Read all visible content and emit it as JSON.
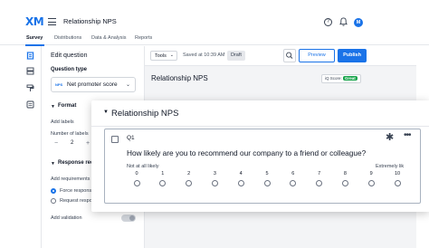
{
  "app": {
    "logo": "XM",
    "project_title": "Relationship NPS"
  },
  "header_icons": [
    "hamburger-icon",
    "help-icon",
    "bell-icon"
  ],
  "user": {
    "avatar_initial": "M"
  },
  "tabs": [
    {
      "label": "Survey",
      "active": true
    },
    {
      "label": "Distributions",
      "active": false
    },
    {
      "label": "Data & Analysis",
      "active": false
    },
    {
      "label": "Reports",
      "active": false
    }
  ],
  "rail_icons": [
    "survey-flow-icon",
    "blocks-icon",
    "paint-roller-icon",
    "document-icon"
  ],
  "edit_panel": {
    "title": "Edit question",
    "question_type_label": "Question type",
    "question_type_icon": "NPS",
    "question_type_value": "Net promoter score",
    "format_label": "Format",
    "add_labels": "Add labels",
    "number_of_labels": "Number of labels",
    "stepper_minus": "−",
    "stepper_value": "2",
    "stepper_plus": "+",
    "response_req_label": "Response requ",
    "add_requirements": "Add requirements",
    "force_response": "Force respons",
    "request_response": "Request respo",
    "add_validation": "Add validation"
  },
  "toolbar": {
    "tools_label": "Tools",
    "tools_chevron": "⌄",
    "saved_text": "Saved at 10:39 AM",
    "draft_badge": "Draft",
    "preview_label": "Preview",
    "publish_label": "Publish"
  },
  "canvas": {
    "block_title": "Relationship NPS",
    "iq_score_label": "iQ Score:",
    "iq_score_value": "Great"
  },
  "floating_card": {
    "block_title": "Relationship NPS",
    "question_id": "Q1",
    "question_text": "How likely are you to recommend our company to a friend or colleague?",
    "left_label": "Not at all likely",
    "right_label": "Extremely lik",
    "scale": [
      "0",
      "1",
      "2",
      "3",
      "4",
      "5",
      "6",
      "7",
      "8",
      "9",
      "10"
    ]
  },
  "colors": {
    "accent": "#1a73e8",
    "iq_great": "#16a34a"
  }
}
